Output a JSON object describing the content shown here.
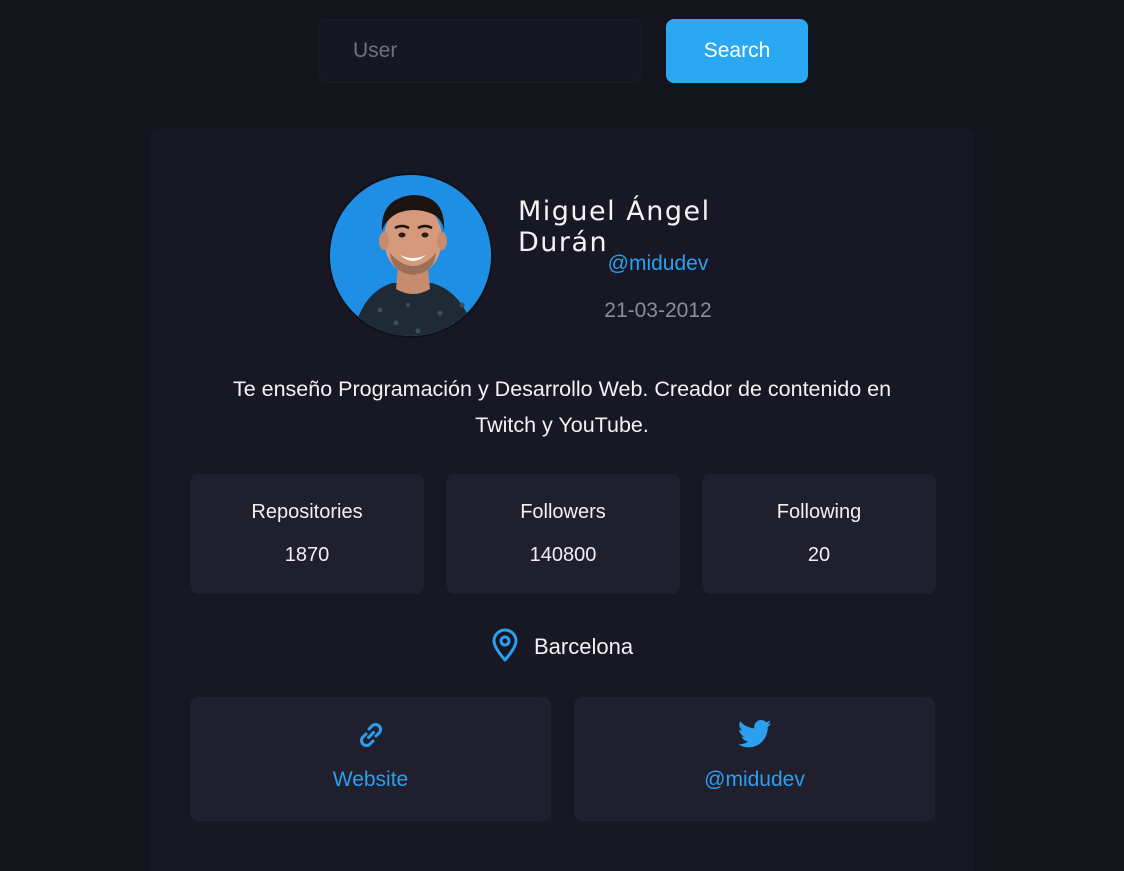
{
  "search": {
    "placeholder": "User",
    "button_label": "Search"
  },
  "profile": {
    "name": "Miguel Ángel Durán",
    "login": "@midudev",
    "joined": "21-03-2012",
    "bio": "Te enseño Programación y Desarrollo Web. Creador de contenido en Twitch y YouTube.",
    "avatar_icon": "avatar-photo"
  },
  "stats": [
    {
      "label": "Repositories",
      "value": "1870"
    },
    {
      "label": "Followers",
      "value": "140800"
    },
    {
      "label": "Following",
      "value": "20"
    }
  ],
  "location": {
    "icon": "map-pin-icon",
    "text": "Barcelona"
  },
  "links": [
    {
      "icon": "link-icon",
      "label": "Website"
    },
    {
      "icon": "twitter-icon",
      "label": "@midudev"
    }
  ],
  "colors": {
    "background": "#14141d",
    "card": "#181824",
    "tile": "#1f1f2e",
    "accent": "#2aa9f2"
  }
}
